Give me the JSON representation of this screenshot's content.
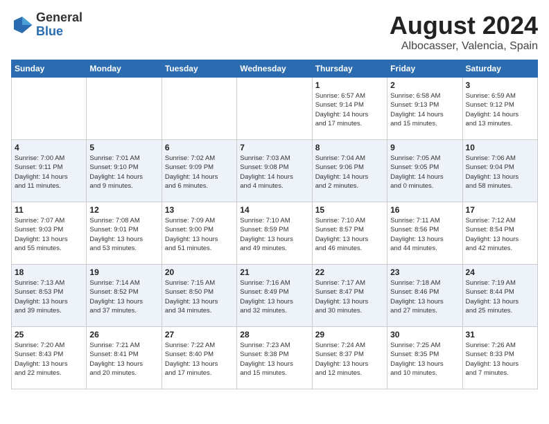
{
  "header": {
    "logo_general": "General",
    "logo_blue": "Blue",
    "title": "August 2024",
    "subtitle": "Albocasser, Valencia, Spain"
  },
  "calendar": {
    "days_of_week": [
      "Sunday",
      "Monday",
      "Tuesday",
      "Wednesday",
      "Thursday",
      "Friday",
      "Saturday"
    ],
    "weeks": [
      [
        {
          "day": "",
          "info": ""
        },
        {
          "day": "",
          "info": ""
        },
        {
          "day": "",
          "info": ""
        },
        {
          "day": "",
          "info": ""
        },
        {
          "day": "1",
          "info": "Sunrise: 6:57 AM\nSunset: 9:14 PM\nDaylight: 14 hours\nand 17 minutes."
        },
        {
          "day": "2",
          "info": "Sunrise: 6:58 AM\nSunset: 9:13 PM\nDaylight: 14 hours\nand 15 minutes."
        },
        {
          "day": "3",
          "info": "Sunrise: 6:59 AM\nSunset: 9:12 PM\nDaylight: 14 hours\nand 13 minutes."
        }
      ],
      [
        {
          "day": "4",
          "info": "Sunrise: 7:00 AM\nSunset: 9:11 PM\nDaylight: 14 hours\nand 11 minutes."
        },
        {
          "day": "5",
          "info": "Sunrise: 7:01 AM\nSunset: 9:10 PM\nDaylight: 14 hours\nand 9 minutes."
        },
        {
          "day": "6",
          "info": "Sunrise: 7:02 AM\nSunset: 9:09 PM\nDaylight: 14 hours\nand 6 minutes."
        },
        {
          "day": "7",
          "info": "Sunrise: 7:03 AM\nSunset: 9:08 PM\nDaylight: 14 hours\nand 4 minutes."
        },
        {
          "day": "8",
          "info": "Sunrise: 7:04 AM\nSunset: 9:06 PM\nDaylight: 14 hours\nand 2 minutes."
        },
        {
          "day": "9",
          "info": "Sunrise: 7:05 AM\nSunset: 9:05 PM\nDaylight: 14 hours\nand 0 minutes."
        },
        {
          "day": "10",
          "info": "Sunrise: 7:06 AM\nSunset: 9:04 PM\nDaylight: 13 hours\nand 58 minutes."
        }
      ],
      [
        {
          "day": "11",
          "info": "Sunrise: 7:07 AM\nSunset: 9:03 PM\nDaylight: 13 hours\nand 55 minutes."
        },
        {
          "day": "12",
          "info": "Sunrise: 7:08 AM\nSunset: 9:01 PM\nDaylight: 13 hours\nand 53 minutes."
        },
        {
          "day": "13",
          "info": "Sunrise: 7:09 AM\nSunset: 9:00 PM\nDaylight: 13 hours\nand 51 minutes."
        },
        {
          "day": "14",
          "info": "Sunrise: 7:10 AM\nSunset: 8:59 PM\nDaylight: 13 hours\nand 49 minutes."
        },
        {
          "day": "15",
          "info": "Sunrise: 7:10 AM\nSunset: 8:57 PM\nDaylight: 13 hours\nand 46 minutes."
        },
        {
          "day": "16",
          "info": "Sunrise: 7:11 AM\nSunset: 8:56 PM\nDaylight: 13 hours\nand 44 minutes."
        },
        {
          "day": "17",
          "info": "Sunrise: 7:12 AM\nSunset: 8:54 PM\nDaylight: 13 hours\nand 42 minutes."
        }
      ],
      [
        {
          "day": "18",
          "info": "Sunrise: 7:13 AM\nSunset: 8:53 PM\nDaylight: 13 hours\nand 39 minutes."
        },
        {
          "day": "19",
          "info": "Sunrise: 7:14 AM\nSunset: 8:52 PM\nDaylight: 13 hours\nand 37 minutes."
        },
        {
          "day": "20",
          "info": "Sunrise: 7:15 AM\nSunset: 8:50 PM\nDaylight: 13 hours\nand 34 minutes."
        },
        {
          "day": "21",
          "info": "Sunrise: 7:16 AM\nSunset: 8:49 PM\nDaylight: 13 hours\nand 32 minutes."
        },
        {
          "day": "22",
          "info": "Sunrise: 7:17 AM\nSunset: 8:47 PM\nDaylight: 13 hours\nand 30 minutes."
        },
        {
          "day": "23",
          "info": "Sunrise: 7:18 AM\nSunset: 8:46 PM\nDaylight: 13 hours\nand 27 minutes."
        },
        {
          "day": "24",
          "info": "Sunrise: 7:19 AM\nSunset: 8:44 PM\nDaylight: 13 hours\nand 25 minutes."
        }
      ],
      [
        {
          "day": "25",
          "info": "Sunrise: 7:20 AM\nSunset: 8:43 PM\nDaylight: 13 hours\nand 22 minutes."
        },
        {
          "day": "26",
          "info": "Sunrise: 7:21 AM\nSunset: 8:41 PM\nDaylight: 13 hours\nand 20 minutes."
        },
        {
          "day": "27",
          "info": "Sunrise: 7:22 AM\nSunset: 8:40 PM\nDaylight: 13 hours\nand 17 minutes."
        },
        {
          "day": "28",
          "info": "Sunrise: 7:23 AM\nSunset: 8:38 PM\nDaylight: 13 hours\nand 15 minutes."
        },
        {
          "day": "29",
          "info": "Sunrise: 7:24 AM\nSunset: 8:37 PM\nDaylight: 13 hours\nand 12 minutes."
        },
        {
          "day": "30",
          "info": "Sunrise: 7:25 AM\nSunset: 8:35 PM\nDaylight: 13 hours\nand 10 minutes."
        },
        {
          "day": "31",
          "info": "Sunrise: 7:26 AM\nSunset: 8:33 PM\nDaylight: 13 hours\nand 7 minutes."
        }
      ]
    ]
  }
}
